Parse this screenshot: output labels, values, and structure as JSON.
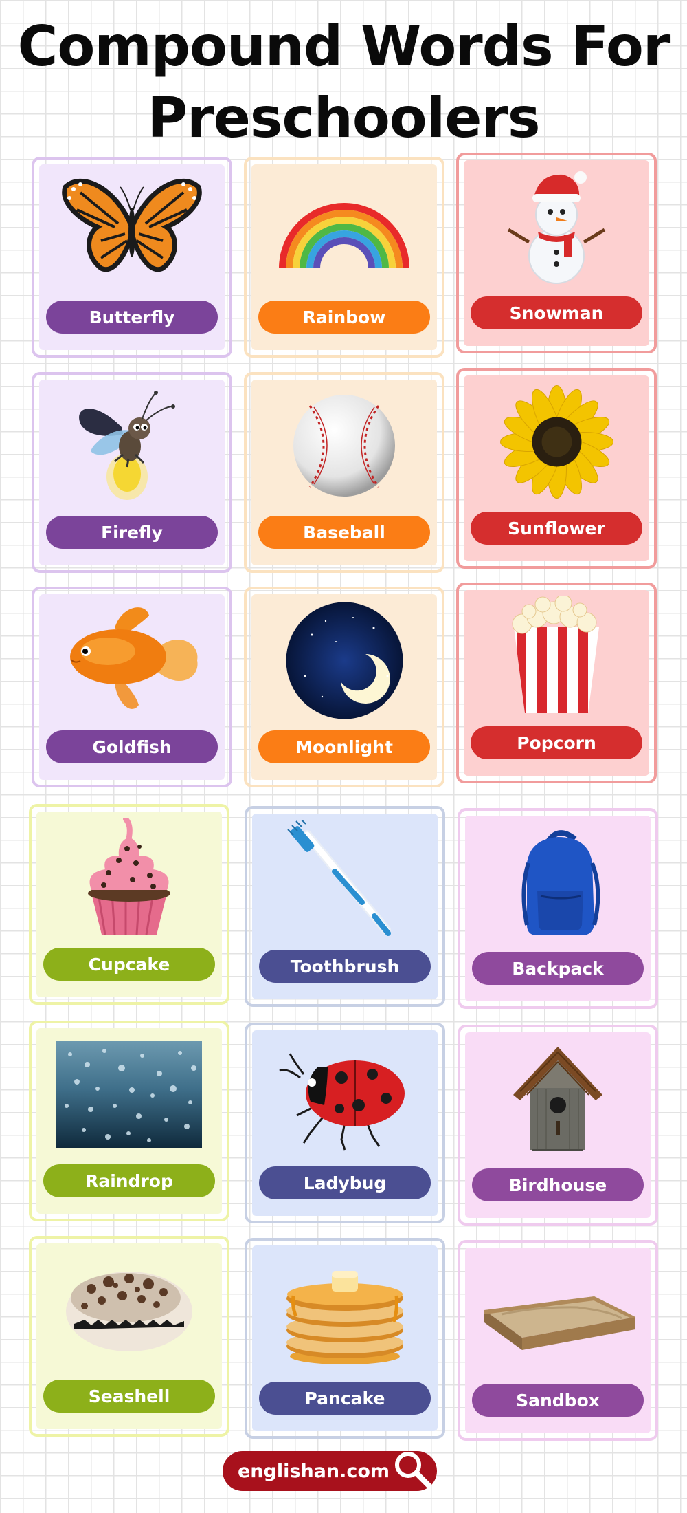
{
  "title": {
    "line1": "Compound Words For",
    "line2": "Preschoolers"
  },
  "cards": [
    {
      "label": "Butterfly",
      "icon": "butterfly-icon",
      "theme": "purple"
    },
    {
      "label": "Rainbow",
      "icon": "rainbow-icon",
      "theme": "orange"
    },
    {
      "label": "Snowman",
      "icon": "snowman-icon",
      "theme": "red"
    },
    {
      "label": "Firefly",
      "icon": "firefly-icon",
      "theme": "purple"
    },
    {
      "label": "Baseball",
      "icon": "baseball-icon",
      "theme": "orange"
    },
    {
      "label": "Sunflower",
      "icon": "sunflower-icon",
      "theme": "red"
    },
    {
      "label": "Goldfish",
      "icon": "goldfish-icon",
      "theme": "purple"
    },
    {
      "label": "Moonlight",
      "icon": "moonlight-icon",
      "theme": "orange"
    },
    {
      "label": "Popcorn",
      "icon": "popcorn-icon",
      "theme": "red"
    },
    {
      "label": "Cupcake",
      "icon": "cupcake-icon",
      "theme": "lime"
    },
    {
      "label": "Toothbrush",
      "icon": "toothbrush-icon",
      "theme": "blue"
    },
    {
      "label": "Backpack",
      "icon": "backpack-icon",
      "theme": "pink"
    },
    {
      "label": "Raindrop",
      "icon": "raindrop-icon",
      "theme": "lime"
    },
    {
      "label": "Ladybug",
      "icon": "ladybug-icon",
      "theme": "blue"
    },
    {
      "label": "Birdhouse",
      "icon": "birdhouse-icon",
      "theme": "pink"
    },
    {
      "label": "Seashell",
      "icon": "seashell-icon",
      "theme": "lime"
    },
    {
      "label": "Pancake",
      "icon": "pancake-icon",
      "theme": "blue"
    },
    {
      "label": "Sandbox",
      "icon": "sandbox-icon",
      "theme": "pink"
    }
  ],
  "colors": {
    "purple": "#7b449a",
    "orange": "#fb7d15",
    "red": "#d52e2e",
    "lime": "#8db01a",
    "blue": "#4b4f92",
    "pink": "#8f4a9d",
    "footer": "#a8111c"
  },
  "footer": {
    "site": "englishan.com",
    "icon": "magnifier-icon"
  }
}
